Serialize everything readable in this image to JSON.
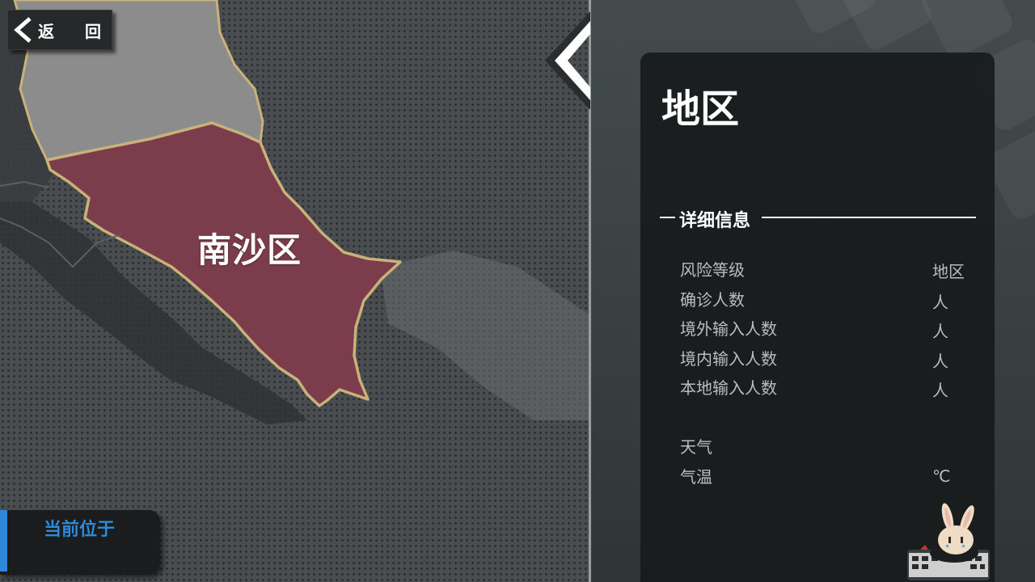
{
  "header": {
    "back_button": {
      "label_left": "返",
      "label_right": "回",
      "icon": "chevron-left-icon"
    },
    "collapse_icon": "chevron-left-icon"
  },
  "map": {
    "highlighted_district": "南沙区",
    "highlight_color": "#7b3d4b",
    "border_color": "#c9b27a",
    "neighbor_color": "#8c8c8c"
  },
  "panel": {
    "title": "地区",
    "section_title": "详细信息",
    "rows": [
      {
        "label": "风险等级",
        "value": "地区"
      },
      {
        "label": "确诊人数",
        "value": "人"
      },
      {
        "label": "境外输入人数",
        "value": "人"
      },
      {
        "label": "境内输入人数",
        "value": "人"
      },
      {
        "label": "本地输入人数",
        "value": "人"
      }
    ],
    "weather": {
      "label": "天气",
      "temperature_label": "气温",
      "temperature_unit": "℃"
    }
  },
  "current_location": {
    "label": "当前位于",
    "accent_color": "#2e87d8"
  }
}
